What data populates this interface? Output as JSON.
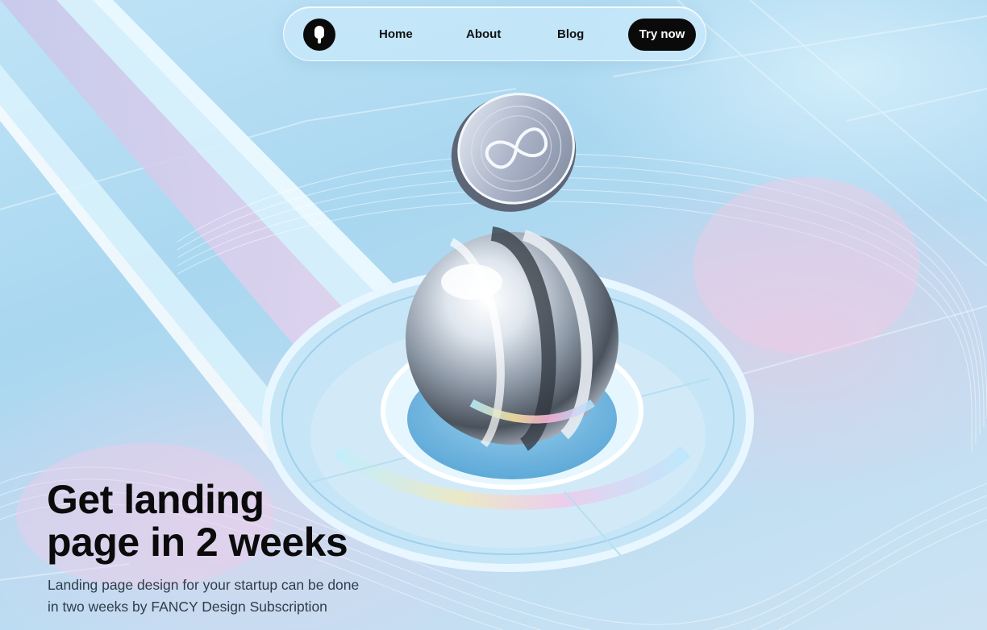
{
  "nav": {
    "logo_icon": "brand-logo-icon",
    "links": [
      "Home",
      "About",
      "Blog"
    ],
    "cta_label": "Try now"
  },
  "hero": {
    "title_lines": [
      "Get landing",
      "page in 2 weeks"
    ],
    "subtitle_lines": [
      "Landing page design for your startup can be done",
      "in two weeks by FANCY Design Subscription"
    ]
  },
  "colors": {
    "background": "#b7dcf2",
    "accent_pink": "#f0c8e1",
    "button": "#0a0a0a",
    "text": "#0b0b0b"
  }
}
